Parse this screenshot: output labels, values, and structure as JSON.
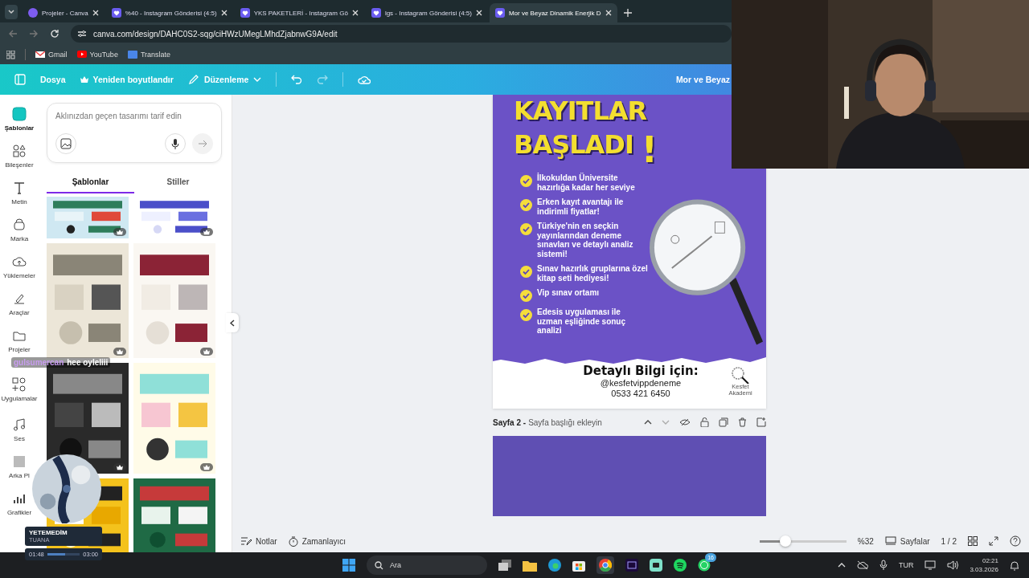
{
  "browser": {
    "tabs": [
      {
        "title": "Projeler - Canva",
        "selected": false
      },
      {
        "title": "%40 - Instagram Gönderisi (4:5)",
        "selected": false
      },
      {
        "title": "YKS PAKETLERİ - Instagram Gö",
        "selected": false
      },
      {
        "title": "lgs - Instagram Gönderisi (4:5)",
        "selected": false
      },
      {
        "title": "Mor ve Beyaz Dinamik Enerjik D",
        "selected": true
      }
    ],
    "url": "canva.com/design/DAHC0S2-sqg/ciHWzUMegLMhdZjabnwG9A/edit",
    "bookmarks": [
      "Gmail",
      "YouTube",
      "Translate"
    ]
  },
  "editor_toolbar": {
    "file": "Dosya",
    "resize": "Yeniden boyutlandır",
    "edit": "Düzenleme",
    "design_title": "Mor ve Beyaz"
  },
  "rail": [
    {
      "label": "Şablonlar",
      "selected": true
    },
    {
      "label": "Bileşenler",
      "selected": false
    },
    {
      "label": "Metin",
      "selected": false
    },
    {
      "label": "Marka",
      "selected": false
    },
    {
      "label": "Yüklemeler",
      "selected": false
    },
    {
      "label": "Araçlar",
      "selected": false
    },
    {
      "label": "Projeler",
      "selected": false
    },
    {
      "label": "Uygulamalar",
      "selected": false
    },
    {
      "label": "Ses",
      "selected": false
    },
    {
      "label": "Arka Pl",
      "selected": false
    },
    {
      "label": "Grafikler",
      "selected": false
    }
  ],
  "prompt": {
    "placeholder": "Aklınızdan geçen tasarımı tarif edin"
  },
  "panel_tabs": [
    {
      "label": "Şablonlar",
      "selected": true
    },
    {
      "label": "Stiller",
      "selected": false
    }
  ],
  "templates": [
    {
      "kind": "picture",
      "premium": true
    },
    {
      "kind": "picture",
      "premium": true
    },
    {
      "kind": "picture",
      "premium": true
    },
    {
      "kind": "picture",
      "premium": true
    },
    {
      "kind": "picture",
      "premium": true
    },
    {
      "kind": "picture",
      "premium": true
    },
    {
      "kind": "picture",
      "premium": false
    },
    {
      "kind": "picture",
      "premium": false
    }
  ],
  "design": {
    "headline": "KAYITLAR",
    "headline_2": "BAŞLADI",
    "exclaim": "!",
    "bullets": [
      "İlkokuldan Üniversite hazırlığa kadar her seviye",
      "Erken kayıt avantajı ile indirimli fiyatlar!",
      "Türkiye'nin en seçkin yayınlarından deneme sınavları ve detaylı analiz sistemi!",
      "Sınav hazırlık gruplarına özel kitap seti hediyesi!",
      "Vip sınav ortamı",
      "Edesis uygulaması ile uzman eşliğinde sonuç analizi"
    ],
    "contact_heading": "Detaylı Bilgi için:",
    "handle": "@kesfetvippdeneme",
    "phone": "0533 421 6450",
    "logo_text": "Kesfet Akademi"
  },
  "page_2": {
    "label": "Sayfa 2 -",
    "title_placeholder": "Sayfa başlığı ekleyin"
  },
  "bottom_bar": {
    "notes": "Notlar",
    "timer": "Zamanlayıcı",
    "zoom": {
      "level": 0.3,
      "reading": "%32"
    },
    "pages": "Sayfalar",
    "page_count": "1 / 2"
  },
  "stream": {
    "chat": {
      "user": "gulsumercan",
      "message": "hee oyleliii"
    },
    "player": {
      "title": "YETEMEDİM",
      "artist": "TUANA",
      "elapsed": "01:48",
      "total": "03:00",
      "level": 0.55
    }
  },
  "taskbar": {
    "search": "Ara",
    "whatsapp_badge": "16",
    "language": "TUR",
    "time": "02:21",
    "date": "3.03.2026"
  }
}
